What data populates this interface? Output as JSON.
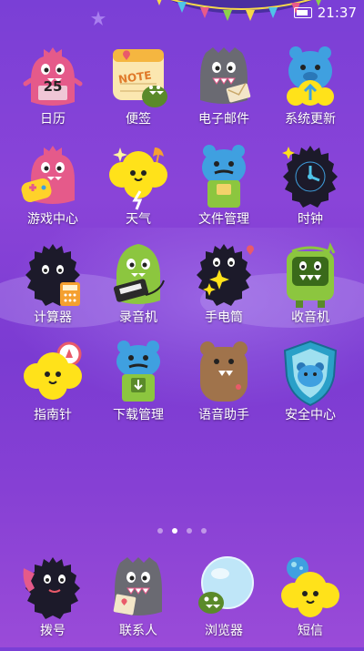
{
  "status": {
    "time": "21:37"
  },
  "apps": [
    {
      "label": "日历",
      "icon": "pink-monster-calendar-icon",
      "badge": "25"
    },
    {
      "label": "便签",
      "icon": "note-pad-icon",
      "badge": "NOTE"
    },
    {
      "label": "电子邮件",
      "icon": "gray-monster-mail-icon"
    },
    {
      "label": "系统更新",
      "icon": "blue-bear-update-icon"
    },
    {
      "label": "游戏中心",
      "icon": "pink-monster-gamepad-icon"
    },
    {
      "label": "天气",
      "icon": "yellow-cloud-weather-icon"
    },
    {
      "label": "文件管理",
      "icon": "blue-bear-files-icon"
    },
    {
      "label": "时钟",
      "icon": "black-fuzzy-clock-icon"
    },
    {
      "label": "计算器",
      "icon": "black-fuzzy-calculator-icon"
    },
    {
      "label": "录音机",
      "icon": "green-monster-recorder-icon"
    },
    {
      "label": "手电筒",
      "icon": "black-fuzzy-flashlight-icon"
    },
    {
      "label": "收音机",
      "icon": "green-radio-monster-icon"
    },
    {
      "label": "指南针",
      "icon": "yellow-cloud-compass-icon"
    },
    {
      "label": "下载管理",
      "icon": "blue-bear-download-icon"
    },
    {
      "label": "语音助手",
      "icon": "brown-bear-assistant-icon"
    },
    {
      "label": "安全中心",
      "icon": "shield-bear-security-icon"
    }
  ],
  "pager": {
    "count": 4,
    "active": 1
  },
  "dock": [
    {
      "label": "拨号",
      "icon": "black-fuzzy-phone-icon"
    },
    {
      "label": "联系人",
      "icon": "gray-monster-contacts-icon"
    },
    {
      "label": "浏览器",
      "icon": "globe-monster-browser-icon"
    },
    {
      "label": "短信",
      "icon": "yellow-cloud-messages-icon"
    }
  ],
  "colors": {
    "background": "#7b3bd2",
    "pink_monster": "#e55a8a",
    "blue_bear": "#3fa0e0",
    "yellow_cloud": "#ffe21a",
    "green_monster": "#8cc63f",
    "gray_monster": "#6a6a72",
    "brown_bear": "#a0734b",
    "black_fuzzy": "#1c1a2a"
  }
}
